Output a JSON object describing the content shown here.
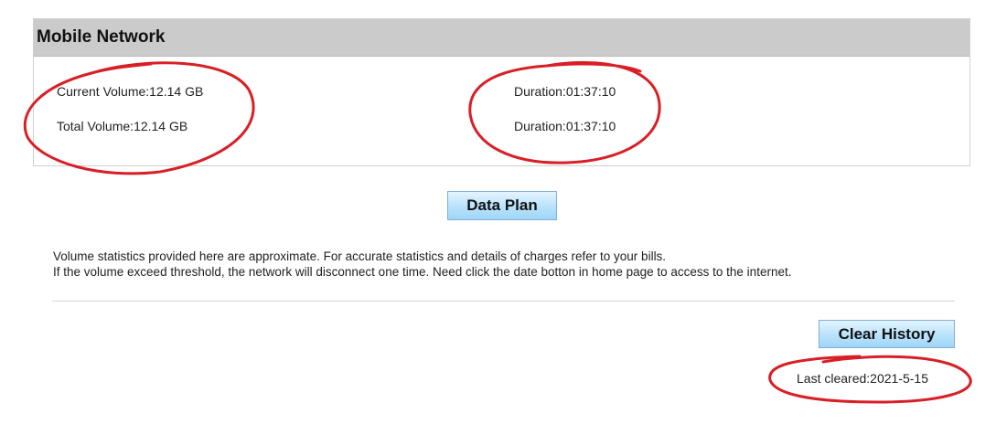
{
  "panel": {
    "title": "Mobile Network"
  },
  "stats": {
    "current_volume_label": "Current Volume:",
    "current_volume_value": "12.14 GB",
    "total_volume_label": "Total Volume:",
    "total_volume_value": "12.14 GB",
    "current_duration_label": "Duration:",
    "current_duration_value": "01:37:10",
    "total_duration_label": "Duration:",
    "total_duration_value": "01:37:10"
  },
  "buttons": {
    "data_plan": "Data Plan",
    "clear_history": "Clear History"
  },
  "notes": {
    "line1": "Volume statistics provided here are approximate. For accurate statistics and details of charges refer to your bills.",
    "line2": "If the volume exceed threshold, the network will disconnect one time. Need click the date botton in home page to access to the internet."
  },
  "history": {
    "last_cleared_label": "Last cleared:",
    "last_cleared_value": "2021-5-15"
  },
  "colors": {
    "annotation_stroke": "#d91f26",
    "header_bg": "#cbcbcb",
    "button_accent": "#b8e2fb"
  }
}
